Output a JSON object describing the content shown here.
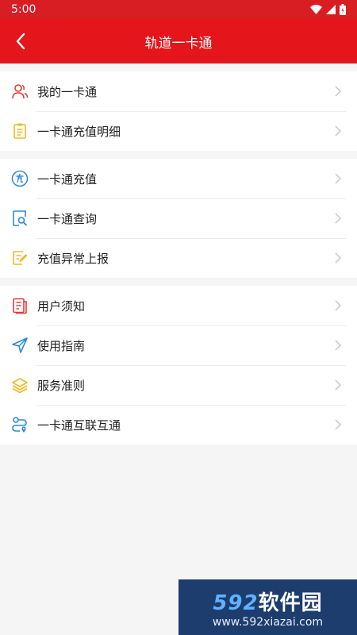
{
  "status_bar": {
    "time": "5:00"
  },
  "app_bar": {
    "title": "轨道一卡通"
  },
  "groups": [
    {
      "items": [
        {
          "label": "我的一卡通",
          "icon": "user-icon"
        },
        {
          "label": "一卡通充值明细",
          "icon": "clipboard-list-icon"
        }
      ]
    },
    {
      "items": [
        {
          "label": "一卡通充值",
          "icon": "recharge-icon"
        },
        {
          "label": "一卡通查询",
          "icon": "document-search-icon"
        },
        {
          "label": "充值异常上报",
          "icon": "edit-report-icon"
        }
      ]
    },
    {
      "items": [
        {
          "label": "用户须知",
          "icon": "notice-icon"
        },
        {
          "label": "使用指南",
          "icon": "navigation-arrow-icon"
        },
        {
          "label": "服务准则",
          "icon": "layers-icon"
        },
        {
          "label": "一卡通互联互通",
          "icon": "route-icon"
        }
      ]
    }
  ],
  "watermark": {
    "number": "592",
    "name": "软件园",
    "url": "www.592xiazai.com"
  },
  "colors": {
    "header": "#e5151c",
    "icon_red": "#e53935",
    "icon_yellow": "#f2b820",
    "icon_blue": "#2a8ad8",
    "chevron": "#c8c8c8"
  }
}
